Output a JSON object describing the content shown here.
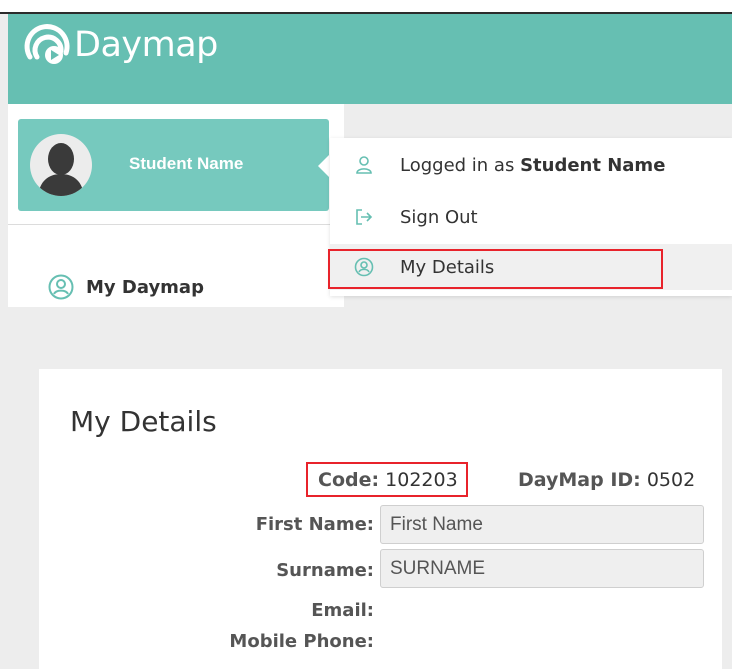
{
  "app": {
    "title": "Daymap"
  },
  "user": {
    "name": "Student Name"
  },
  "nav": {
    "items": [
      {
        "label": "My Daymap",
        "icon": "user-circle-icon"
      }
    ]
  },
  "dropdown": {
    "logged_in_prefix": "Logged in as ",
    "logged_in_name": "Student Name",
    "sign_out": "Sign Out",
    "my_details": "My Details"
  },
  "details": {
    "title": "My Details",
    "code_label": "Code:",
    "code_value": "102203",
    "daymap_id_label": "DayMap ID:",
    "daymap_id_value": "0502",
    "fields": [
      {
        "label": "First Name:",
        "value": "First Name"
      },
      {
        "label": "Surname:",
        "value": "SURNAME"
      },
      {
        "label": "Email:",
        "value": ""
      },
      {
        "label": "Mobile Phone:",
        "value": ""
      }
    ]
  },
  "colors": {
    "brand": "#66bfb2",
    "card": "#76c9be",
    "highlight": "#e8232b"
  }
}
